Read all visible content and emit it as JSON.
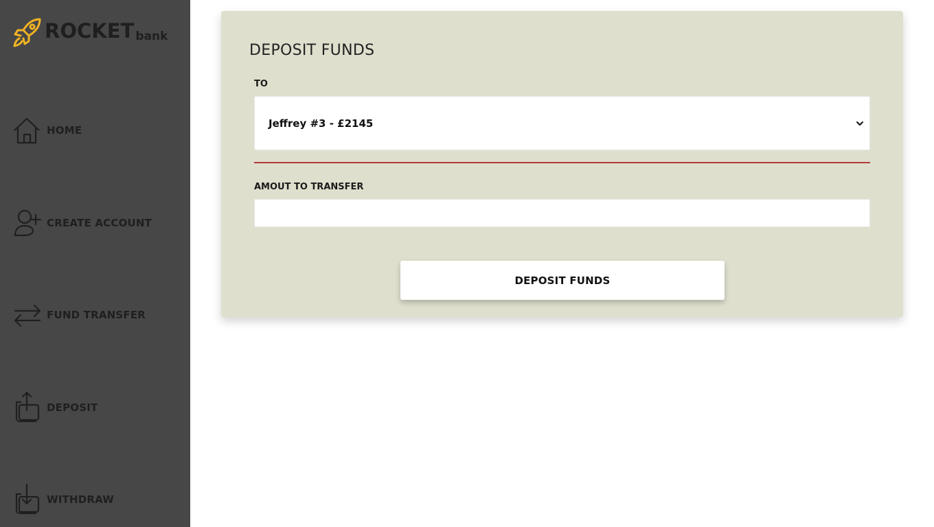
{
  "brand": {
    "name": "ROCKET",
    "sub": "bank",
    "accent_color": "#f0b323"
  },
  "sidebar": {
    "items": [
      {
        "label": "HOME",
        "icon": "home-icon"
      },
      {
        "label": "CREATE ACCOUNT",
        "icon": "add-user-icon"
      },
      {
        "label": "FUND TRANSFER",
        "icon": "transfer-arrows-icon"
      },
      {
        "label": "DEPOSIT",
        "icon": "upload-icon"
      },
      {
        "label": "WITHDRAW",
        "icon": "download-icon"
      }
    ]
  },
  "form": {
    "title": "DEPOSIT FUNDS",
    "to_label": "TO",
    "to_selected": "Jeffrey #3 - £2145",
    "amount_label": "AMOUT TO TRANSFER",
    "amount_value": "",
    "submit_label": "DEPOSIT FUNDS"
  }
}
